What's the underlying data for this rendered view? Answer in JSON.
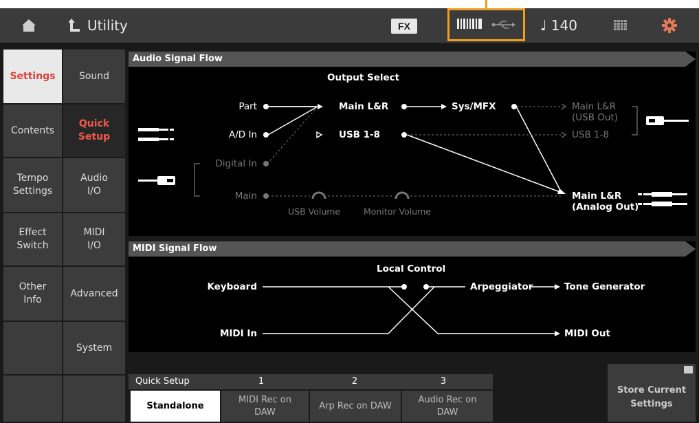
{
  "header": {
    "title": "Utility",
    "fx_label": "FX",
    "tempo": "♩ 140"
  },
  "tabs_left": [
    {
      "label": "Settings",
      "selected": true
    },
    {
      "label": "Contents",
      "selected": false
    },
    {
      "label": "Tempo\nSettings",
      "selected": false
    },
    {
      "label": "Effect\nSwitch",
      "selected": false
    },
    {
      "label": "Other\nInfo",
      "selected": false
    }
  ],
  "tabs_right": [
    {
      "label": "Sound",
      "selected": false
    },
    {
      "label": "Quick\nSetup",
      "selected": true
    },
    {
      "label": "Audio\nI/O",
      "selected": false
    },
    {
      "label": "MIDI\nI/O",
      "selected": false
    },
    {
      "label": "Advanced",
      "selected": false
    },
    {
      "label": "System",
      "selected": false
    }
  ],
  "audio_flow": {
    "title": "Audio Signal Flow",
    "output_select": "Output Select",
    "part": "Part",
    "ad_in": "A/D In",
    "digital_in": "Digital In",
    "main": "Main",
    "main_lr": "Main L&R",
    "usb18": "USB 1-8",
    "sys_mfx": "Sys/MFX",
    "out_main_usb_1": "Main L&R",
    "out_main_usb_2": "(USB Out)",
    "out_usb18": "USB 1-8",
    "out_main_analog_1": "Main L&R",
    "out_main_analog_2": "(Analog Out)",
    "usb_volume": "USB Volume",
    "monitor_volume": "Monitor Volume"
  },
  "midi_flow": {
    "title": "MIDI Signal Flow",
    "local_control": "Local Control",
    "keyboard": "Keyboard",
    "midi_in": "MIDI In",
    "arpeggiator": "Arpeggiator",
    "tone_generator": "Tone Generator",
    "midi_out": "MIDI Out"
  },
  "quick_setup": {
    "label": "Quick Setup",
    "col1": "1",
    "col2": "2",
    "col3": "3",
    "buttons": [
      {
        "label": "Standalone",
        "selected": true
      },
      {
        "label": "MIDI Rec on\nDAW",
        "selected": false
      },
      {
        "label": "Arp Rec on DAW",
        "selected": false
      },
      {
        "label": "Audio Rec on\nDAW",
        "selected": false
      }
    ]
  },
  "store_button": "Store Current\nSettings",
  "colors": {
    "accent_orange": "#f0a020",
    "selected_red": "#e0403a"
  }
}
